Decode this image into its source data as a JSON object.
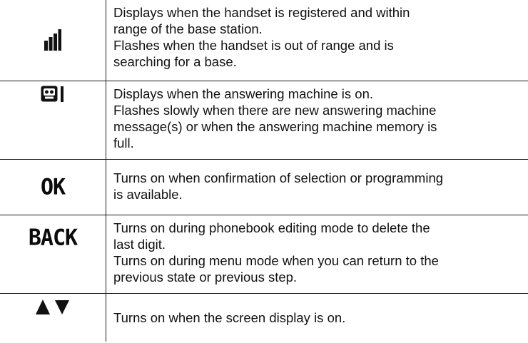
{
  "rows": [
    {
      "icon": "signal-strength-icon",
      "lines": [
        "Displays when the handset is registered and within",
        "range of the base station.",
        "Flashes when the handset is out of range and is",
        "searching for a base."
      ]
    },
    {
      "icon": "answering-machine-icon",
      "lines": [
        "Displays when the answering machine is on.",
        "Flashes slowly when there are new answering machine",
        "message(s) or when the answering machine memory is",
        "full."
      ]
    },
    {
      "icon_text": "OK",
      "icon": "ok-icon",
      "lines": [
        "Turns on when confirmation of selection or programming",
        "is available."
      ]
    },
    {
      "icon_text": "BACK",
      "icon": "back-icon",
      "lines": [
        "Turns on during phonebook editing mode to delete the",
        "last digit.",
        "Turns on during menu mode when you can return to the",
        "previous state or previous step."
      ]
    },
    {
      "icon": "up-down-arrows-icon",
      "lines": [
        "Turns on when the screen display is on."
      ]
    }
  ]
}
